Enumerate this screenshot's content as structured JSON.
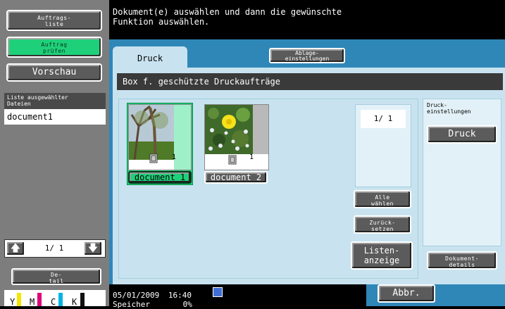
{
  "left": {
    "job_list_label": "Auftrags-\nliste",
    "check_job_label": "Auftrag\nprüfen",
    "preview_label": "Vorschau",
    "selected_files_header": "Liste ausgewählter\nDateien",
    "selected_files": [
      "document1"
    ],
    "page_counter": "1/  1",
    "detail_label": "De-\ntail",
    "toner": [
      {
        "name": "Y",
        "color": "#f3e600"
      },
      {
        "name": "M",
        "color": "#e0007a"
      },
      {
        "name": "C",
        "color": "#00b3e6"
      },
      {
        "name": "K",
        "color": "#111111"
      }
    ]
  },
  "header": {
    "message": "Dokument(e) auswählen und dann die gewünschte\nFunktion auswählen."
  },
  "tabs": [
    {
      "label": "Druck",
      "active": true
    },
    {
      "label": "Ablage-\neinstellungen",
      "active": false
    }
  ],
  "box_title": "Box f. geschützte Druckaufträge",
  "documents": [
    {
      "name": "document 1",
      "count": "1",
      "selected": true
    },
    {
      "name": "document 2",
      "count": "1",
      "selected": false
    }
  ],
  "page_indicator": "1/  1",
  "buttons": {
    "select_all": "Alle\nwählen",
    "reset": "Zurück-\nsetzen",
    "list_view": "Listen-\nanzeige",
    "print_settings_header": "Druck-\neinstellungen",
    "print": "Druck",
    "doc_details": "Dokument-\ndetails",
    "cancel": "Abbr."
  },
  "status": {
    "date": "05/01/2009",
    "time": "16:40",
    "memory_label": "Speicher",
    "memory_value": "0%"
  },
  "colors": {
    "panel_blue": "#c8e3ef",
    "tab_blue": "#2f87b8",
    "accent_green": "#1fd07a"
  }
}
